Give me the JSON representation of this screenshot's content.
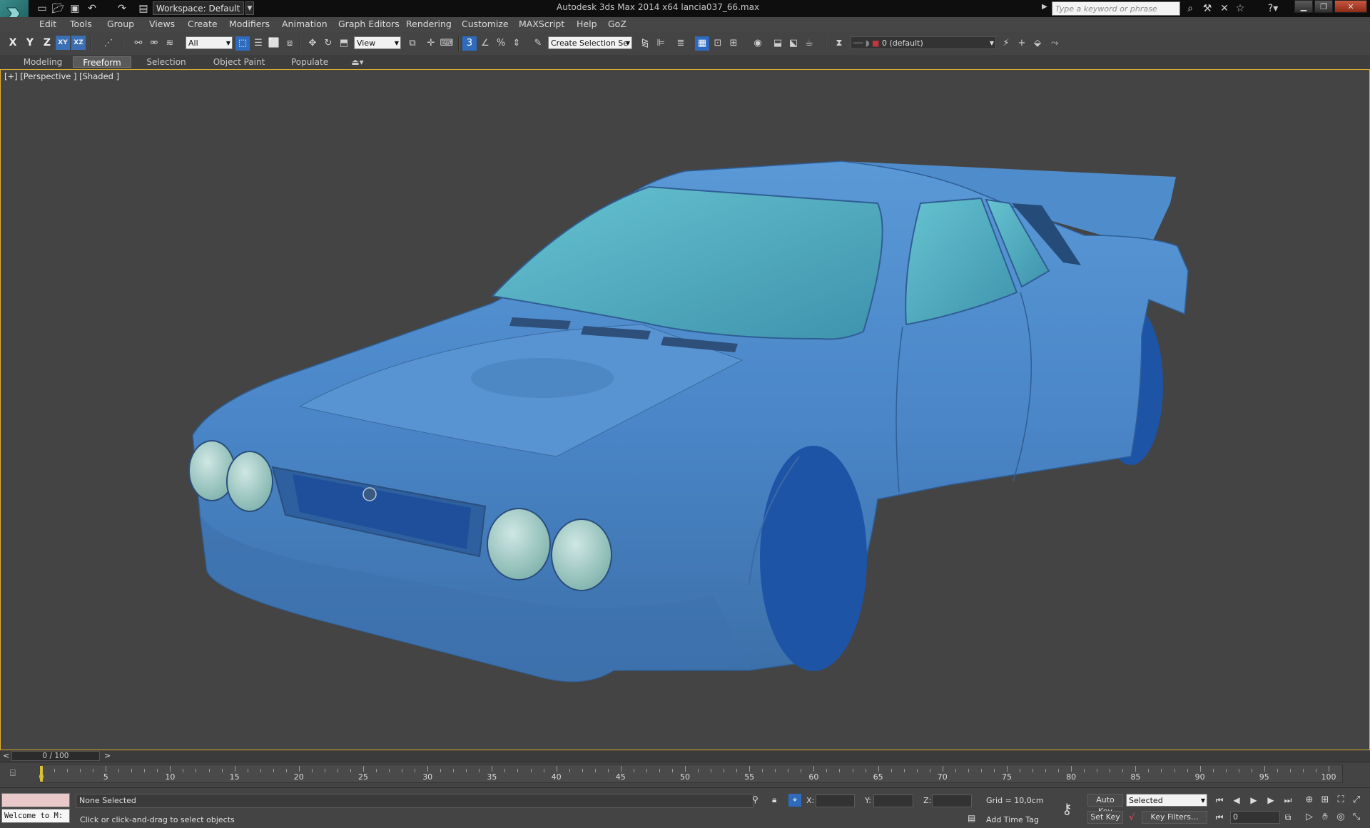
{
  "titlebar": {
    "workspace": "Workspace: Default",
    "title": "Autodesk 3ds Max  2014 x64      lancia037_66.max",
    "search_placeholder": "Type a keyword or phrase"
  },
  "menu": [
    "Edit",
    "Tools",
    "Group",
    "Views",
    "Create",
    "Modifiers",
    "Animation",
    "Graph Editors",
    "Rendering",
    "Customize",
    "MAXScript",
    "Help",
    "GoZ"
  ],
  "toolbar": {
    "axis_x": "X",
    "axis_y": "Y",
    "axis_z": "Z",
    "axis_xy": "XY",
    "axis_xz": "XZ",
    "selection_filter": "All",
    "ref_coord": "View",
    "selection_set": "Create Selection Se",
    "layer": "0 (default)"
  },
  "ribbon": {
    "tabs": [
      "Modeling",
      "Freeform",
      "Selection",
      "Object Paint",
      "Populate"
    ],
    "active": "Freeform"
  },
  "viewport": {
    "label": "[+] [Perspective ] [Shaded ]",
    "border_color": "#e0b030",
    "object_color": "#4a86c8",
    "wheel_color": "#1e55a8",
    "glass_color": "#4ea8bc"
  },
  "timeline": {
    "slider_label": "0 / 100",
    "prev": "<",
    "next": ">",
    "current_frame": 0,
    "ticks": [
      "0",
      "5",
      "10",
      "15",
      "20",
      "25",
      "30",
      "35",
      "40",
      "45",
      "50",
      "55",
      "60",
      "65",
      "70",
      "75",
      "80",
      "85",
      "90",
      "95",
      "100"
    ]
  },
  "status": {
    "maxscript_text": "Welcome to M:",
    "selection": "None Selected",
    "prompt": "Click or click-and-drag to select objects",
    "x_label": "X:",
    "y_label": "Y:",
    "z_label": "Z:",
    "grid": "Grid = 10,0cm",
    "add_time_tag": "Add Time Tag",
    "auto_key": "Auto Key",
    "set_key": "Set Key",
    "key_mode": "Selected",
    "key_filters": "Key Filters...",
    "frame": "0"
  }
}
